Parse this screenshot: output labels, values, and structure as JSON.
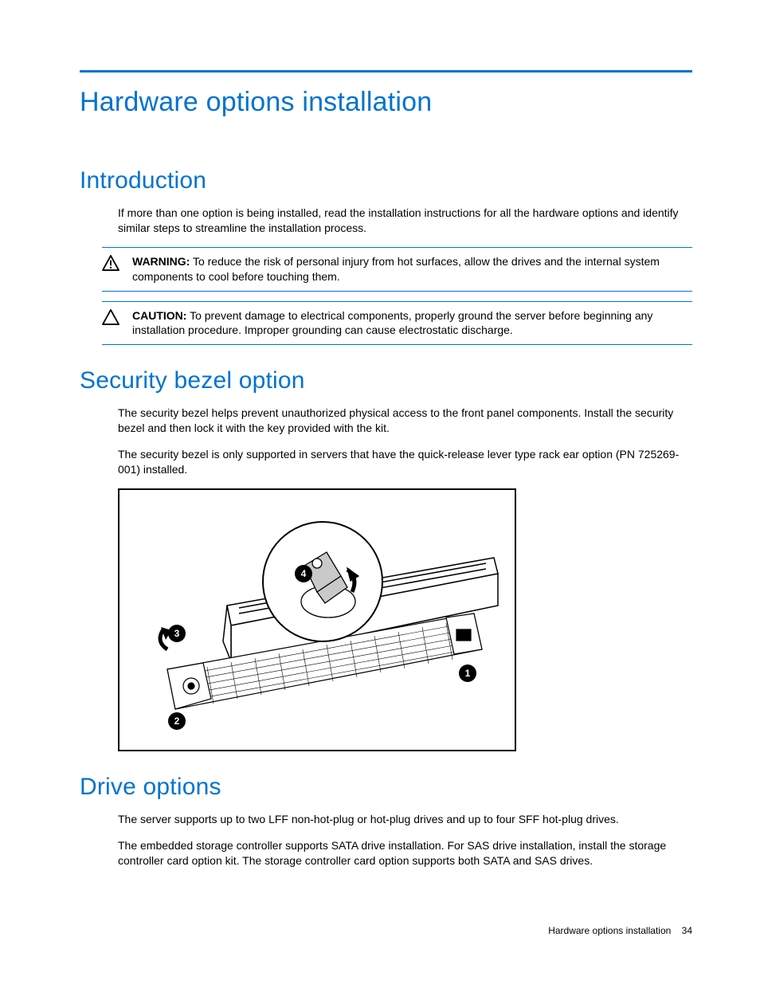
{
  "page_title": "Hardware options installation",
  "sections": {
    "intro": {
      "heading": "Introduction",
      "p1": "If more than one option is being installed, read the installation instructions for all the hardware options and identify similar steps to streamline the installation process.",
      "warning": {
        "label": "WARNING:",
        "text": " To reduce the risk of personal injury from hot surfaces, allow the drives and the internal system components to cool before touching them."
      },
      "caution": {
        "label": "CAUTION:",
        "text": " To prevent damage to electrical components, properly ground the server before beginning any installation procedure. Improper grounding can cause electrostatic discharge."
      }
    },
    "bezel": {
      "heading": "Security bezel option",
      "p1": "The security bezel helps prevent unauthorized physical access to the front panel components. Install the security bezel and then lock it with the key provided with the kit.",
      "p2": "The security bezel is only supported in servers that have the quick-release lever type rack ear option (PN 725269-001) installed.",
      "callouts": [
        "1",
        "2",
        "3",
        "4"
      ]
    },
    "drives": {
      "heading": "Drive options",
      "p1": "The server supports up to two LFF non-hot-plug or hot-plug drives and up to four SFF hot-plug drives.",
      "p2": "The embedded storage controller supports SATA drive installation. For SAS drive installation, install the storage controller card option kit. The storage controller card option supports both SATA and SAS drives."
    }
  },
  "footer": {
    "title": "Hardware options installation",
    "page": "34"
  }
}
